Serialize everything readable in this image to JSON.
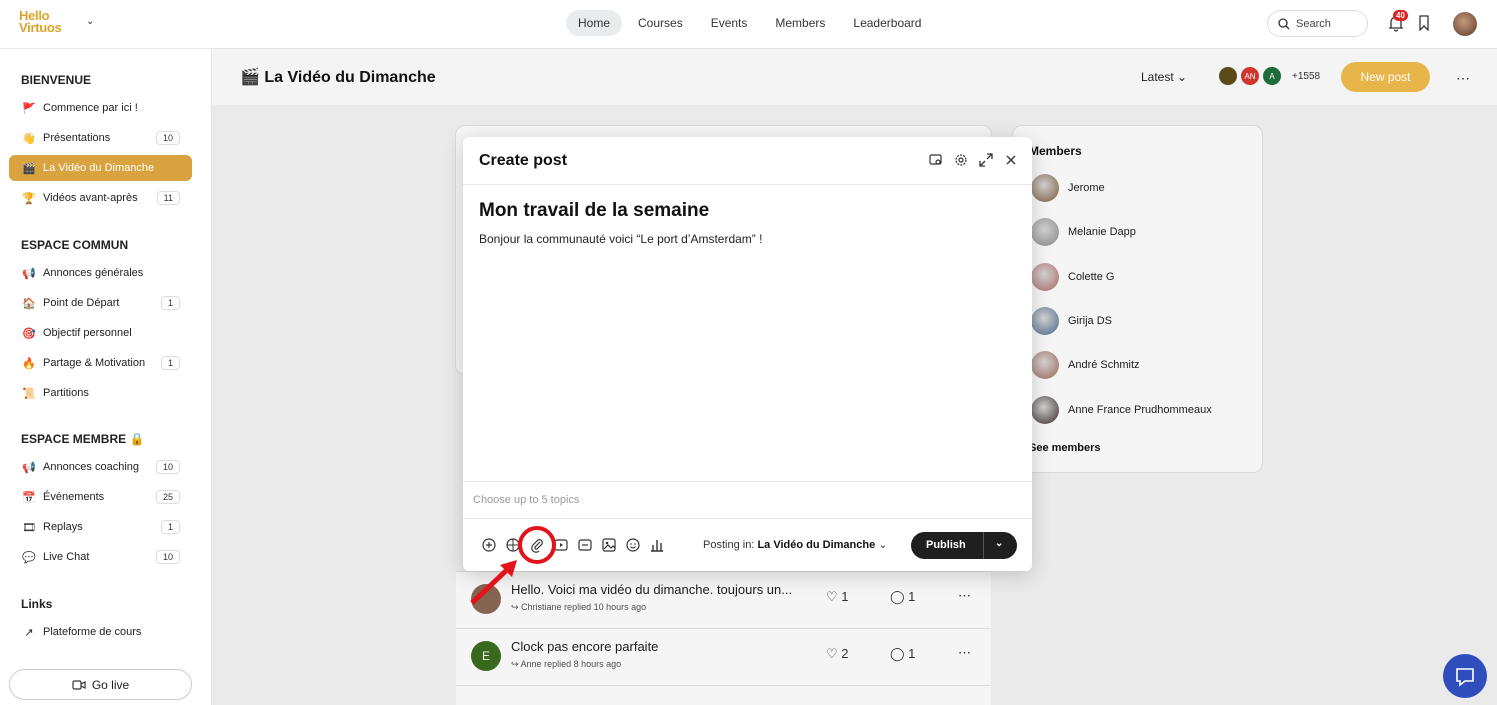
{
  "app": {
    "logo_line1": "Hello",
    "logo_line2": "Virtuos"
  },
  "topnav": {
    "items": [
      "Home",
      "Courses",
      "Events",
      "Members",
      "Leaderboard"
    ],
    "active": "Home",
    "search_label": "Search",
    "notif_count": "40"
  },
  "sidebar": {
    "sections": [
      {
        "title": "BIENVENUE",
        "items": [
          {
            "icon": "🚩",
            "label": "Commence par ici !",
            "count": ""
          },
          {
            "icon": "👋",
            "label": "Présentations",
            "count": "10"
          },
          {
            "icon": "🎬",
            "label": "La Vidéo du Dimanche",
            "count": "",
            "active": true
          },
          {
            "icon": "🏆",
            "label": "Vidéos avant-après",
            "count": "11"
          }
        ]
      },
      {
        "title": "ESPACE COMMUN",
        "items": [
          {
            "icon": "📢",
            "label": "Annonces générales",
            "count": ""
          },
          {
            "icon": "🏠",
            "label": "Point de Départ",
            "count": "1"
          },
          {
            "icon": "🎯",
            "label": "Objectif personnel",
            "count": ""
          },
          {
            "icon": "🔥",
            "label": "Partage & Motivation",
            "count": "1"
          },
          {
            "icon": "📜",
            "label": "Partitions",
            "count": ""
          }
        ]
      },
      {
        "title": "ESPACE MEMBRE 🔒",
        "items": [
          {
            "icon": "📢",
            "label": "Annonces coaching",
            "count": "10"
          },
          {
            "icon": "📅",
            "label": "Événements",
            "count": "25"
          },
          {
            "icon": "🎞",
            "label": "Replays",
            "count": "1"
          },
          {
            "icon": "💬",
            "label": "Live Chat",
            "count": "10"
          }
        ]
      },
      {
        "title": "Links",
        "items": [
          {
            "icon": "↗",
            "label": "Plateforme de cours",
            "count": ""
          }
        ]
      }
    ],
    "golive": "Go live"
  },
  "space": {
    "icon": "🎬",
    "title": "La Vidéo du Dimanche",
    "sort": "Latest",
    "avatars": [
      "",
      "AN",
      "A"
    ],
    "avatar_colors": [
      "#5a4a1a",
      "#d0342c",
      "#1f6b3a"
    ],
    "member_more": "+1558",
    "new_post": "New post"
  },
  "members": {
    "title": "Members",
    "list": [
      "Jerome",
      "Melanie Dapp",
      "Colette G",
      "Girija DS",
      "André Schmitz",
      "Anne France Prudhommeaux"
    ],
    "see_all": "See members"
  },
  "feed": [
    {
      "title": "Hello.  Voici ma vidéo  du dimanche. toujours un...",
      "sub": "Christiane replied 10 hours ago",
      "likes": "1",
      "comments": "1",
      "avatar": "",
      "color": "#8a6a55"
    },
    {
      "title": "Clock pas encore parfaite",
      "sub": "Anne replied 8 hours ago",
      "likes": "2",
      "comments": "1",
      "avatar": "E",
      "color": "#3b6d1e"
    }
  ],
  "modal": {
    "title": "Create post",
    "post_title": "Mon travail de la semaine",
    "post_body": "Bonjour la communauté voici “Le port d’Amsterdam” !",
    "topics_placeholder": "Choose up to 5 topics",
    "posting_prefix": "Posting in:",
    "posting_space": "La Vidéo du Dimanche",
    "publish": "Publish"
  }
}
